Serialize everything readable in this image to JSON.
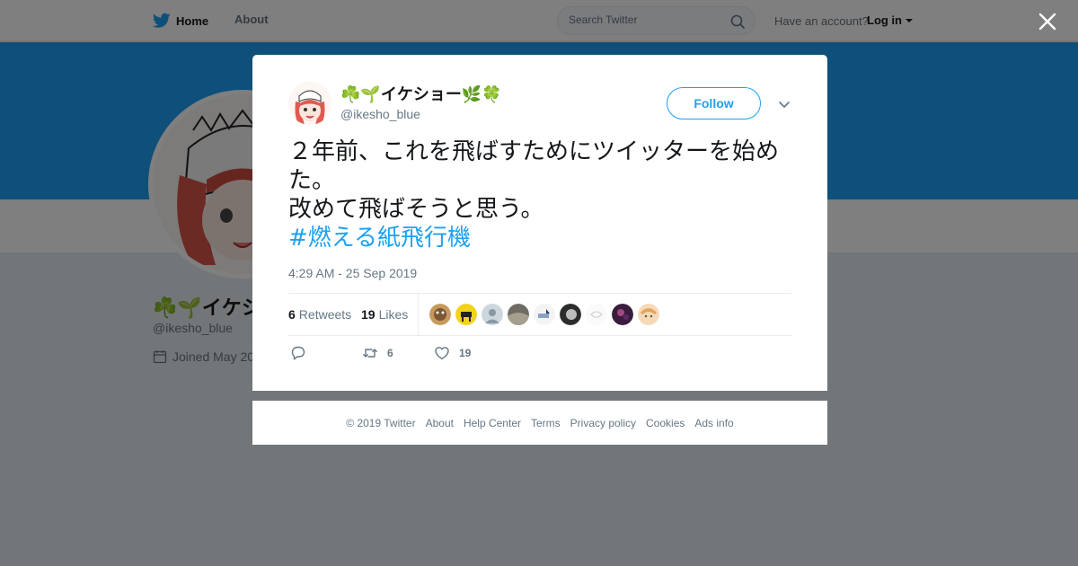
{
  "nav": {
    "home_label": "Home",
    "about_label": "About",
    "search_placeholder": "Search Twitter",
    "account_prompt": "Have an account?",
    "login_label": "Log in",
    "twitter_logo_icon": "twitter-bird-icon",
    "search_icon": "magnifier-icon"
  },
  "profile_background": {
    "name_visible": "☘️🌱イケシ",
    "handle": "@ikesho_blue",
    "joined_visible": "Joined May 20",
    "banner_color": "#1da1f2"
  },
  "tweet": {
    "author_name": "☘️🌱イケショー🌿🍀",
    "author_handle": "@ikesho_blue",
    "follow_label": "Follow",
    "text_line1": "２年前、これを飛ばすためにツイッターを始めた。",
    "text_line2": "改めて飛ばそうと思う。",
    "hashtag": "#燃える紙飛行機",
    "timestamp": "4:29 AM - 25 Sep 2019",
    "retweet_count": "6",
    "retweet_label": "Retweets",
    "like_count": "19",
    "like_label": "Likes",
    "liker_avatar_count": 9,
    "action_retweet_count": "6",
    "action_like_count": "19"
  },
  "footer": {
    "copyright": "© 2019 Twitter",
    "links": [
      "About",
      "Help Center",
      "Terms",
      "Privacy policy",
      "Cookies",
      "Ads info"
    ]
  },
  "colors": {
    "accent": "#1da1f2",
    "text": "#14171a",
    "secondary": "#657786",
    "overlay": "rgba(0,0,0,0.5)"
  }
}
